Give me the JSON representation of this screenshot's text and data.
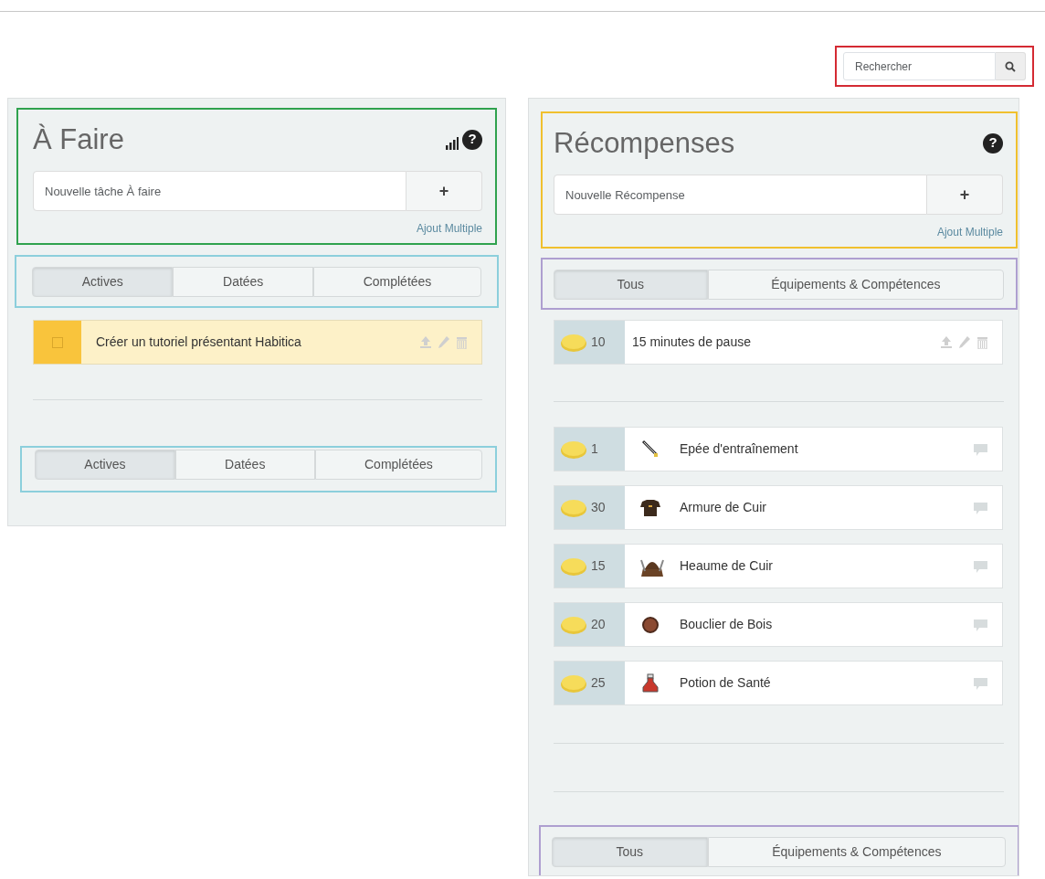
{
  "search": {
    "placeholder": "Rechercher",
    "color": "#d42a33"
  },
  "todos": {
    "title": "À Faire",
    "help": "?",
    "color": "#2fa24e",
    "input": {
      "placeholder": "Nouvelle tâche À faire"
    },
    "add_button": "+",
    "bulk_link": "Ajout Multiple",
    "filters_top": {
      "color": "#8ccfdc",
      "tabs": [
        {
          "label": "Actives",
          "selected": true
        },
        {
          "label": "Datées",
          "selected": false
        },
        {
          "label": "Complétées",
          "selected": false
        }
      ]
    },
    "tasks": [
      {
        "text": "Créer un tutoriel présentant Habitica",
        "checked": false,
        "color": "#f9c43c"
      }
    ],
    "filters_bottom": {
      "color": "#8ccfdc",
      "tabs": [
        {
          "label": "Actives",
          "selected": true
        },
        {
          "label": "Datées",
          "selected": false
        },
        {
          "label": "Complétées",
          "selected": false
        }
      ]
    }
  },
  "rewards": {
    "title": "Récompenses",
    "help": "?",
    "color": "#f0c02e",
    "input": {
      "placeholder": "Nouvelle Récompense"
    },
    "add_button": "+",
    "bulk_link": "Ajout Multiple",
    "filters_top": {
      "color": "#ae9fd0",
      "tabs": [
        {
          "label": "Tous",
          "selected": true
        },
        {
          "label": "Équipements & Compétences",
          "selected": false
        }
      ]
    },
    "custom": [
      {
        "cost": "10",
        "text": "15 minutes de pause"
      }
    ],
    "items": [
      {
        "cost": "1",
        "name": "Epée d'entraînement",
        "kind": "sword"
      },
      {
        "cost": "30",
        "name": "Armure de Cuir",
        "kind": "armor"
      },
      {
        "cost": "15",
        "name": "Heaume de Cuir",
        "kind": "helm"
      },
      {
        "cost": "20",
        "name": "Bouclier de Bois",
        "kind": "shield"
      },
      {
        "cost": "25",
        "name": "Potion de Santé",
        "kind": "potion"
      }
    ],
    "filters_bottom": {
      "color": "#ae9fd0",
      "tabs": [
        {
          "label": "Tous",
          "selected": true
        },
        {
          "label": "Équipements & Compétences",
          "selected": false
        }
      ]
    }
  }
}
